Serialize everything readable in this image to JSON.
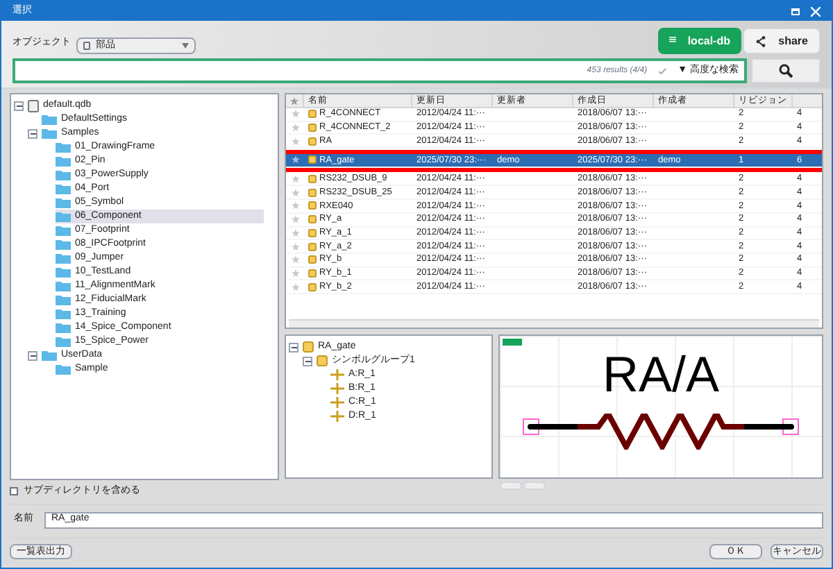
{
  "window": {
    "title": "選択"
  },
  "object": {
    "label": "オブジェクト",
    "value": "部品"
  },
  "db": {
    "label": "local-db",
    "selected": true
  },
  "share": {
    "label": "share"
  },
  "search": {
    "results": "453 results (4/4)",
    "advanced": "▼ 高度な検索"
  },
  "tree": [
    {
      "label": "default.qdb",
      "kind": "db",
      "expanded": true,
      "selected": false,
      "children": [
        {
          "label": "DefaultSettings",
          "kind": "folder",
          "selected": false
        },
        {
          "label": "Samples",
          "kind": "folder",
          "expanded": true,
          "selected": false,
          "children": [
            {
              "label": "01_DrawingFrame",
              "kind": "folder",
              "selected": false
            },
            {
              "label": "02_Pin",
              "kind": "folder",
              "selected": false
            },
            {
              "label": "03_PowerSupply",
              "kind": "folder",
              "selected": false
            },
            {
              "label": "04_Port",
              "kind": "folder",
              "selected": false
            },
            {
              "label": "05_Symbol",
              "kind": "folder",
              "selected": false
            },
            {
              "label": "06_Component",
              "kind": "folder",
              "selected": true
            },
            {
              "label": "07_Footprint",
              "kind": "folder",
              "selected": false
            },
            {
              "label": "08_IPCFootprint",
              "kind": "folder",
              "selected": false
            },
            {
              "label": "09_Jumper",
              "kind": "folder",
              "selected": false
            },
            {
              "label": "10_TestLand",
              "kind": "folder",
              "selected": false
            },
            {
              "label": "11_AlignmentMark",
              "kind": "folder",
              "selected": false
            },
            {
              "label": "12_FiducialMark",
              "kind": "folder",
              "selected": false
            },
            {
              "label": "13_Training",
              "kind": "folder",
              "selected": false
            },
            {
              "label": "14_Spice_Component",
              "kind": "folder",
              "selected": false
            },
            {
              "label": "15_Spice_Power",
              "kind": "folder",
              "selected": false
            }
          ]
        },
        {
          "label": "UserData",
          "kind": "folder",
          "expanded": true,
          "selected": false,
          "children": [
            {
              "label": "Sample",
              "kind": "folder",
              "selected": false
            }
          ]
        }
      ]
    }
  ],
  "subdir": {
    "label": "サブディレクトリを含める",
    "checked": false
  },
  "table": {
    "columns": [
      "名前",
      "更新日",
      "更新者",
      "作成日",
      "作成者",
      "リビジョン"
    ],
    "rows": [
      {
        "cells": [
          "R_4CONNECT",
          "2012/04/24 11:···",
          "",
          "2018/06/07 13:···",
          "",
          "2",
          "4"
        ],
        "selected": false
      },
      {
        "cells": [
          "R_4CONNECT_2",
          "2012/04/24 11:···",
          "",
          "2018/06/07 13:···",
          "",
          "2",
          "4"
        ],
        "selected": false
      },
      {
        "cells": [
          "RA",
          "2012/04/24 11:···",
          "",
          "2018/06/07 13:···",
          "",
          "2",
          "4"
        ],
        "selected": false
      },
      {
        "cells": [
          "RA_gate",
          "2025/07/30 23:···",
          "demo",
          "2025/07/30 23:···",
          "demo",
          "1",
          "6"
        ],
        "selected": true
      },
      {
        "cells": [
          "RS232_DSUB_9",
          "2012/04/24 11:···",
          "",
          "2018/06/07 13:···",
          "",
          "2",
          "4"
        ],
        "selected": false
      },
      {
        "cells": [
          "RS232_DSUB_25",
          "2012/04/24 11:···",
          "",
          "2018/06/07 13:···",
          "",
          "2",
          "4"
        ],
        "selected": false
      },
      {
        "cells": [
          "RXE040",
          "2012/04/24 11:···",
          "",
          "2018/06/07 13:···",
          "",
          "2",
          "4"
        ],
        "selected": false
      },
      {
        "cells": [
          "RY_a",
          "2012/04/24 11:···",
          "",
          "2018/06/07 13:···",
          "",
          "2",
          "4"
        ],
        "selected": false
      },
      {
        "cells": [
          "RY_a_1",
          "2012/04/24 11:···",
          "",
          "2018/06/07 13:···",
          "",
          "2",
          "4"
        ],
        "selected": false
      },
      {
        "cells": [
          "RY_a_2",
          "2012/04/24 11:···",
          "",
          "2018/06/07 13:···",
          "",
          "2",
          "4"
        ],
        "selected": false
      },
      {
        "cells": [
          "RY_b",
          "2012/04/24 11:···",
          "",
          "2018/06/07 13:···",
          "",
          "2",
          "4"
        ],
        "selected": false
      },
      {
        "cells": [
          "RY_b_1",
          "2012/04/24 11:···",
          "",
          "2018/06/07 13:···",
          "",
          "2",
          "4"
        ],
        "selected": false
      },
      {
        "cells": [
          "RY_b_2",
          "2012/04/24 11:···",
          "",
          "2018/06/07 13:···",
          "",
          "2",
          "4"
        ],
        "selected": false
      }
    ]
  },
  "detail": [
    {
      "label": "RA_gate",
      "kind": "part",
      "children": [
        {
          "label": "シンボルグループ1",
          "kind": "group",
          "children": [
            {
              "label": "A:R_1",
              "kind": "pin"
            },
            {
              "label": "B:R_1",
              "kind": "pin"
            },
            {
              "label": "C:R_1",
              "kind": "pin"
            },
            {
              "label": "D:R_1",
              "kind": "pin"
            }
          ]
        }
      ]
    }
  ],
  "preview": {
    "text": "RA/A"
  },
  "name": {
    "label": "名前",
    "value": "RA_gate"
  },
  "buttons": {
    "export": "一覧表出力",
    "ok": "ＯＫ",
    "cancel": "キャンセル"
  }
}
